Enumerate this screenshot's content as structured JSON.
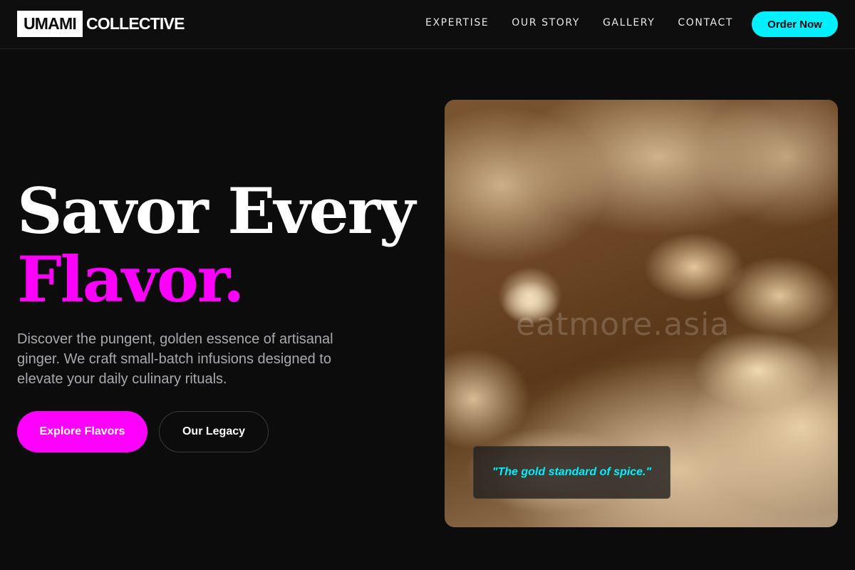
{
  "header": {
    "logo_box": "UMAMI",
    "logo_rest": "COLLECTIVE",
    "nav": [
      {
        "label": "EXPERTISE"
      },
      {
        "label": "OUR STORY"
      },
      {
        "label": "GALLERY"
      },
      {
        "label": "CONTACT"
      }
    ],
    "order_button": "Order Now"
  },
  "hero": {
    "headline_line1": "Savor Every",
    "headline_line2": "Flavor.",
    "description": "Discover the pungent, golden essence of artisanal ginger. We craft small-batch infusions designed to elevate your daily culinary rituals.",
    "primary_button": "Explore Flavors",
    "secondary_button": "Our Legacy",
    "image": {
      "watermark": "eatmore.asia",
      "quote": "\"The gold standard of spice.\""
    }
  },
  "colors": {
    "background": "#0c0c0d",
    "accent_cyan": "#00f0ff",
    "accent_magenta": "#ff00ff",
    "text_muted": "#a9a9ae"
  }
}
